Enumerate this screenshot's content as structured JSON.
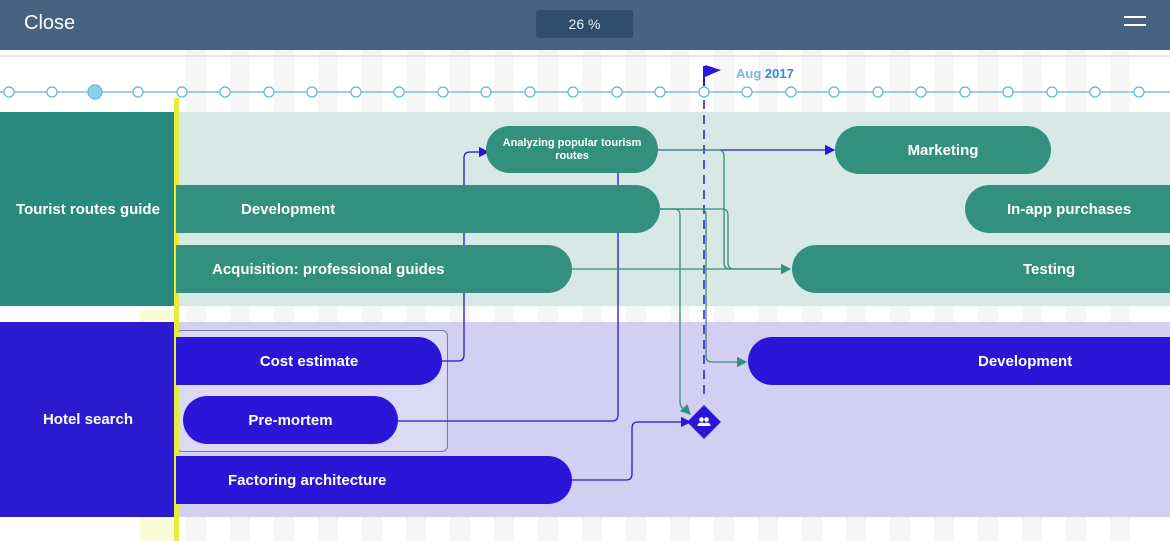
{
  "header": {
    "close_label": "Close",
    "progress_label": "26 %",
    "menu_icon": "hamburger-icon"
  },
  "timeline": {
    "flag_month": "Aug",
    "flag_year": "2017"
  },
  "groups": [
    {
      "name": "Tourist routes guide",
      "tasks": [
        "Analyzing popular tourism routes",
        "Marketing",
        "Development",
        "In-app purchases",
        "Acquisition: professional guides",
        "Testing"
      ]
    },
    {
      "name": "Hotel search",
      "tasks": [
        "Cost estimate",
        "Development",
        "Pre-mortem",
        "Factoring architecture"
      ]
    }
  ],
  "milestone_icon": "people-icon",
  "colors": {
    "header": "#46627f",
    "teal": "#33907f",
    "blue": "#2a16d6",
    "today_marker": "#e4ed3a"
  }
}
